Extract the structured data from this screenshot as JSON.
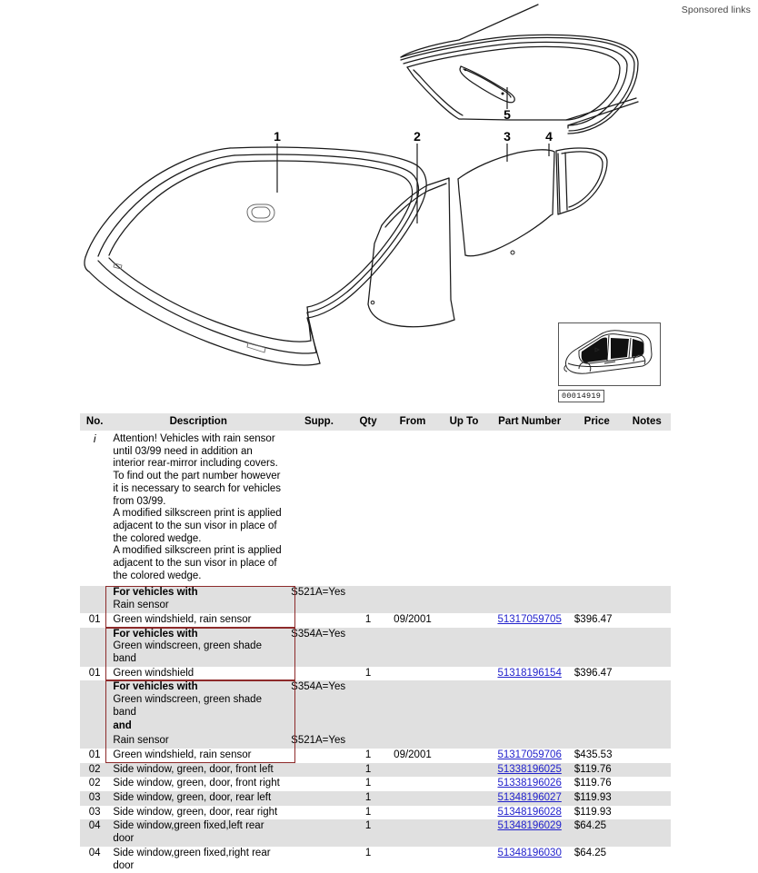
{
  "page": {
    "sponsored_label": "Sponsored links"
  },
  "diagram": {
    "callouts": [
      {
        "id": "1",
        "label": "1"
      },
      {
        "id": "2",
        "label": "2"
      },
      {
        "id": "3",
        "label": "3"
      },
      {
        "id": "4",
        "label": "4"
      },
      {
        "id": "5",
        "label": "5"
      }
    ],
    "thumbnail_label": "00014919"
  },
  "table": {
    "headers": {
      "no": "No.",
      "description": "Description",
      "supp": "Supp.",
      "qty": "Qty",
      "from": "From",
      "upto": "Up To",
      "part_number": "Part Number",
      "price": "Price",
      "notes": "Notes"
    },
    "info_row": {
      "marker": "i",
      "text": "Attention! Vehicles with rain sensor until 03/99 need in addition an interior rear-mirror including covers.\nTo find out the part number however it is necessary to search for vehicles from 03/99.\nA modified silkscreen print is applied adjacent to the sun visor in place of the colored wedge.\nA modified silkscreen print is applied adjacent to the sun visor in place of the colored wedge."
    },
    "groups": [
      {
        "condition": {
          "title": "For vehicles with",
          "lines": [
            {
              "text": "Rain sensor",
              "supp": "S521A=Yes"
            }
          ]
        },
        "parts": [
          {
            "no": "01",
            "description": "Green windshield, rain sensor",
            "supp": "",
            "qty": "1",
            "from": "09/2001",
            "upto": "",
            "part_number": "51317059705",
            "price": "$396.47",
            "notes": ""
          }
        ]
      },
      {
        "condition": {
          "title": "For vehicles with",
          "lines": [
            {
              "text": "Green windscreen, green shade band",
              "supp": "S354A=Yes"
            }
          ]
        },
        "parts": [
          {
            "no": "01",
            "description": "Green windshield",
            "supp": "",
            "qty": "1",
            "from": "",
            "upto": "",
            "part_number": "51318196154",
            "price": "$396.47",
            "notes": ""
          }
        ]
      },
      {
        "condition": {
          "title": "For vehicles with",
          "lines": [
            {
              "text": "Green windscreen, green shade band",
              "supp": "S354A=Yes"
            },
            {
              "text": "and",
              "supp": ""
            },
            {
              "text": "Rain sensor",
              "supp": "S521A=Yes"
            }
          ]
        },
        "parts": [
          {
            "no": "01",
            "description": "Green windshield, rain sensor",
            "supp": "",
            "qty": "1",
            "from": "09/2001",
            "upto": "",
            "part_number": "51317059706",
            "price": "$435.53",
            "notes": ""
          }
        ]
      }
    ],
    "plain_rows": [
      {
        "no": "02",
        "description": "Side window, green, door, front left",
        "supp": "",
        "qty": "1",
        "from": "",
        "upto": "",
        "part_number": "51338196025",
        "price": "$119.76",
        "notes": ""
      },
      {
        "no": "02",
        "description": "Side window, green, door, front right",
        "supp": "",
        "qty": "1",
        "from": "",
        "upto": "",
        "part_number": "51338196026",
        "price": "$119.76",
        "notes": ""
      },
      {
        "no": "03",
        "description": "Side window, green, door, rear left",
        "supp": "",
        "qty": "1",
        "from": "",
        "upto": "",
        "part_number": "51348196027",
        "price": "$119.93",
        "notes": ""
      },
      {
        "no": "03",
        "description": "Side window, green, door, rear right",
        "supp": "",
        "qty": "1",
        "from": "",
        "upto": "",
        "part_number": "51348196028",
        "price": "$119.93",
        "notes": ""
      },
      {
        "no": "04",
        "description": "Side window,green fixed,left rear door",
        "supp": "",
        "qty": "1",
        "from": "",
        "upto": "",
        "part_number": "51348196029",
        "price": "$64.25",
        "notes": ""
      },
      {
        "no": "04",
        "description": "Side window,green fixed,right rear door",
        "supp": "",
        "qty": "1",
        "from": "",
        "upto": "",
        "part_number": "51348196030",
        "price": "$64.25",
        "notes": ""
      }
    ]
  },
  "colors": {
    "header_bg": "#e3e3e3",
    "row_alt_bg": "#e0e0e0",
    "condition_border": "#8d2a2a",
    "link": "#2222cc"
  }
}
